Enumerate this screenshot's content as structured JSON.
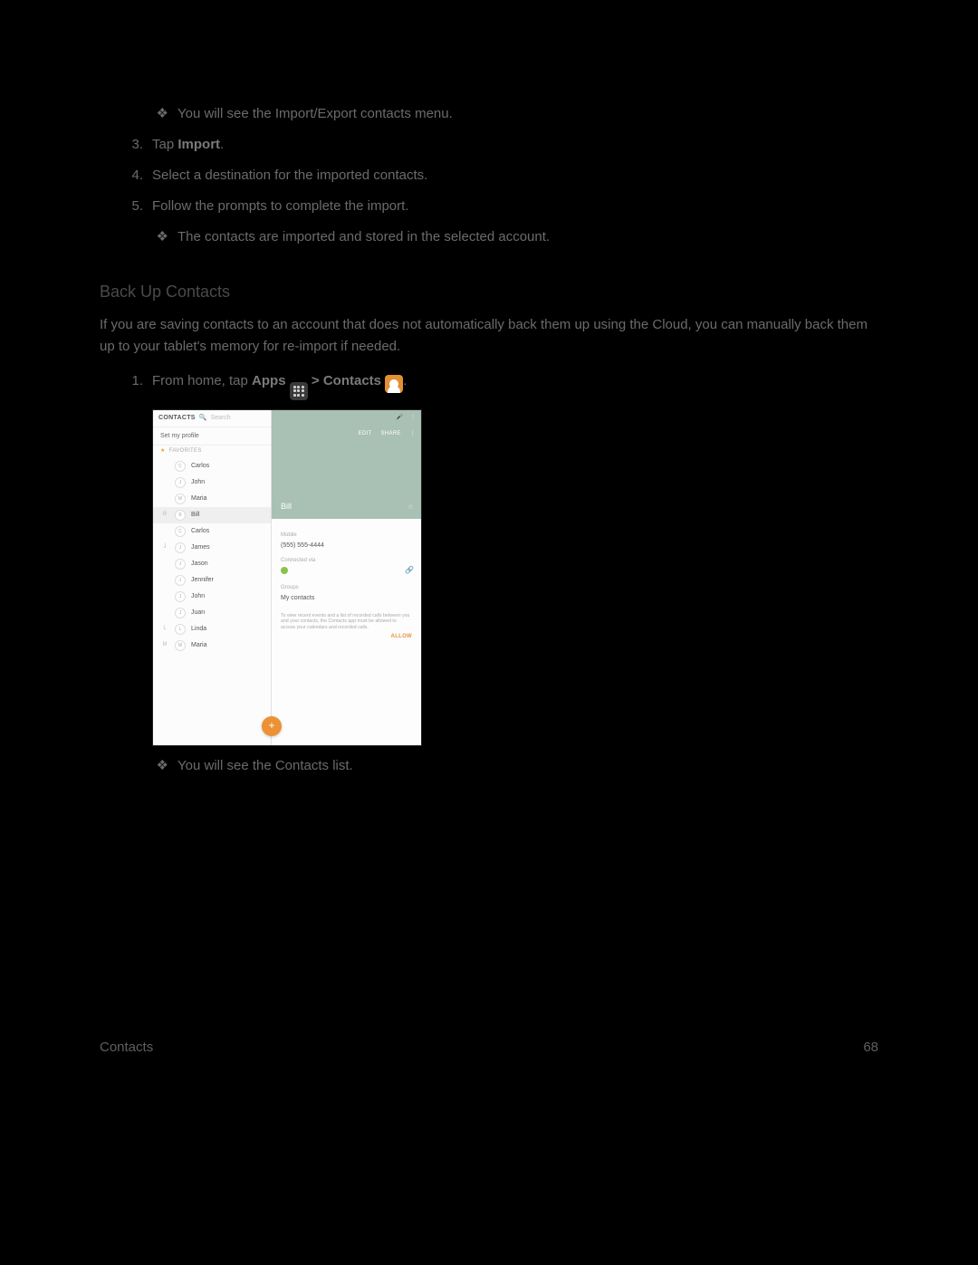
{
  "bullets": {
    "top_note": "You will see the Import/Export contacts menu.",
    "imported_note": "The contacts are imported and stored in the selected account.",
    "contacts_list_note": "You will see the Contacts list."
  },
  "steps": {
    "s3_prefix": "Tap ",
    "s3_bold": "Import",
    "s3_suffix": ".",
    "s4": "Select a destination for the imported contacts.",
    "s5": "Follow the prompts to complete the import."
  },
  "section": {
    "title": "Back Up Contacts",
    "intro": "If you are saving contacts to an account that does not automatically back them up using the Cloud, you can manually back them up to your tablet's memory for re-import if needed."
  },
  "step1": {
    "prefix": "From home, tap ",
    "apps": "Apps",
    "gt": " > ",
    "contacts": "Contacts",
    "suffix": "."
  },
  "screenshot": {
    "header": {
      "title": "CONTACTS",
      "search_placeholder": "Search"
    },
    "profile": "Set my profile",
    "fav_label": "FAVORITES",
    "favorites": [
      {
        "letter": "C",
        "name": "Carlos"
      },
      {
        "letter": "J",
        "name": "John"
      },
      {
        "letter": "M",
        "name": "Maria"
      }
    ],
    "rows": [
      {
        "letter": "B",
        "av": "B",
        "name": "Bill",
        "sel": true
      },
      {
        "letter": "",
        "av": "C",
        "name": "Carlos",
        "sel": false
      },
      {
        "letter": "J",
        "av": "J",
        "name": "James",
        "sel": false
      },
      {
        "letter": "",
        "av": "J",
        "name": "Jason",
        "sel": false
      },
      {
        "letter": "",
        "av": "J",
        "name": "Jennifer",
        "sel": false
      },
      {
        "letter": "",
        "av": "J",
        "name": "John",
        "sel": false
      },
      {
        "letter": "",
        "av": "J",
        "name": "Juan",
        "sel": false
      },
      {
        "letter": "L",
        "av": "L",
        "name": "Linda",
        "sel": false
      },
      {
        "letter": "M",
        "av": "M",
        "name": "Maria",
        "sel": false
      }
    ],
    "right": {
      "edit": "EDIT",
      "share": "SHARE",
      "name": "Bill",
      "mobile_label": "Mobile",
      "mobile_value": "(555) 555-4444",
      "connected_label": "Connected via",
      "groups_label": "Groups",
      "groups_value": "My contacts",
      "note": "To view recent events and a list of recorded calls between you and your contacts, the Contacts app must be allowed to access your calendars and recorded calls.",
      "allow": "ALLOW"
    }
  },
  "footer": {
    "left": "Contacts",
    "right": "68"
  }
}
